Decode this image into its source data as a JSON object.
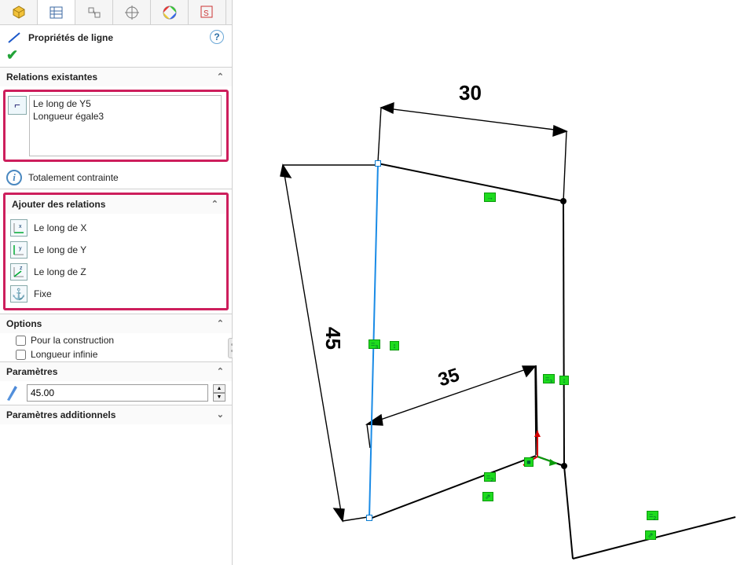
{
  "accent_highlight": "#cd1e5c",
  "panel": {
    "title": "Propriétés de ligne",
    "tabs": [
      "part",
      "display",
      "design",
      "bullseye",
      "appearance",
      "sketch"
    ],
    "relations_header": "Relations existantes",
    "relations": [
      "Le long de Y5",
      "Longueur égale3"
    ],
    "status_text": "Totalement contrainte",
    "add_relations_header": "Ajouter des relations",
    "add_relations": [
      {
        "icon": "xyz-x",
        "label": "Le long de X"
      },
      {
        "icon": "xyz-y",
        "label": "Le long de Y"
      },
      {
        "icon": "xyz-z",
        "label": "Le long de Z"
      },
      {
        "icon": "anchor",
        "label": "Fixe"
      }
    ],
    "options_header": "Options",
    "options": [
      {
        "label": "Pour la construction",
        "checked": false
      },
      {
        "label": "Longueur infinie",
        "checked": false
      }
    ],
    "params_header": "Paramètres",
    "param_value": "45.00",
    "additional_header": "Paramètres additionnels"
  },
  "sketch": {
    "dimensions": {
      "top": "30",
      "left": "45",
      "inner": "35"
    }
  }
}
